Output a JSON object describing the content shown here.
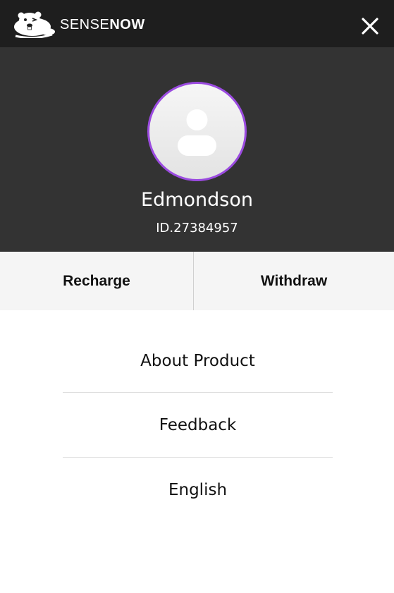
{
  "header": {
    "brand_light": "SENSE",
    "brand_bold": "NOW",
    "logo_icon": "beaver-mascot-icon",
    "close_icon": "close-icon"
  },
  "profile": {
    "name": "Edmondson",
    "id_text": "ID.27384957",
    "avatar_icon": "user-avatar-icon",
    "avatar_ring_color": "#9b4be0"
  },
  "actions": {
    "recharge_label": "Recharge",
    "withdraw_label": "Withdraw"
  },
  "menu": {
    "items": [
      {
        "label": "About Product"
      },
      {
        "label": "Feedback"
      },
      {
        "label": "English"
      }
    ]
  },
  "colors": {
    "topbar": "#1e1e1e",
    "profile_bg": "#333333",
    "action_bg": "#f5f5f5"
  }
}
